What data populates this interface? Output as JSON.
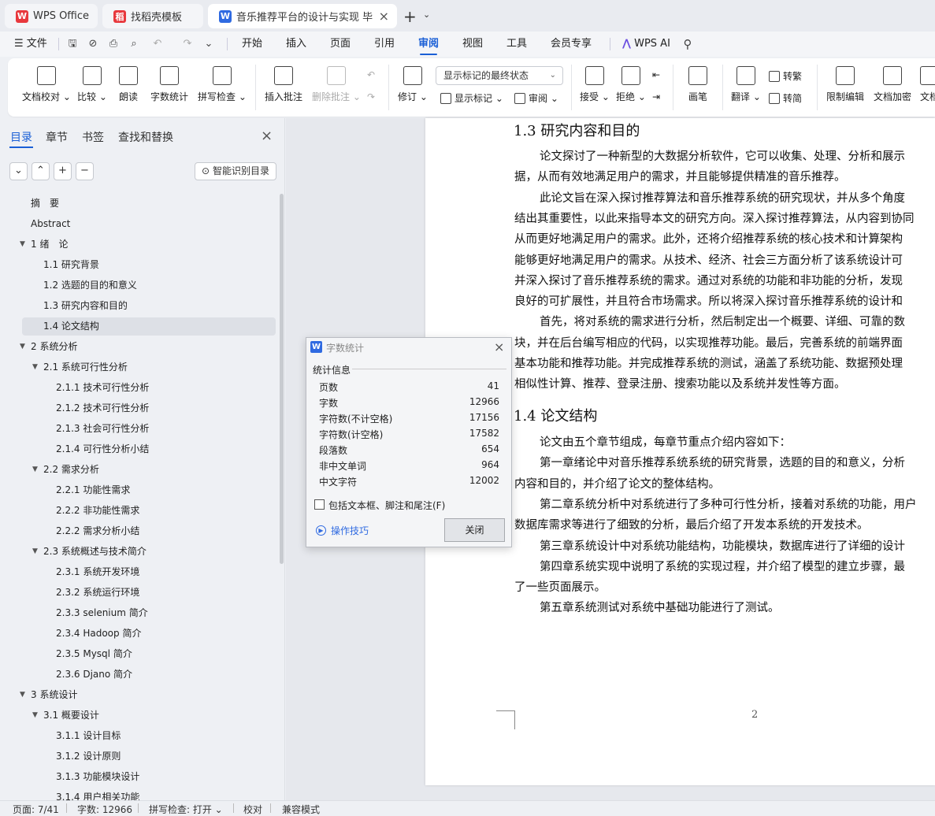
{
  "tabs": {
    "wps": "WPS Office",
    "template": "找稻壳模板",
    "document": "音乐推荐平台的设计与实现 毕"
  },
  "menu": {
    "file": "文件",
    "items": [
      "开始",
      "插入",
      "页面",
      "引用",
      "审阅",
      "视图",
      "工具",
      "会员专享"
    ],
    "active": "审阅",
    "wps_ai": "WPS AI"
  },
  "ribbon": {
    "doc_proof": "文档校对",
    "compare": "比较",
    "read_aloud": "朗读",
    "word_count": "字数统计",
    "spell_check": "拼写检查",
    "insert_comment": "插入批注",
    "delete_comment": "删除批注",
    "markup_mode": "显示标记的最终状态",
    "revise": "修订",
    "show_markup": "显示标记",
    "review": "审阅",
    "accept": "接受",
    "reject": "拒绝",
    "brush": "画笔",
    "translate": "翻译",
    "to_traditional": "转繁",
    "to_simplified": "转简",
    "restrict_edit": "限制编辑",
    "encrypt": "文档加密",
    "doc_more": "文档"
  },
  "nav": {
    "tabs": [
      "目录",
      "章节",
      "书签",
      "查找和替换"
    ],
    "smart_toc": "智能识别目录",
    "toc": [
      {
        "text": "摘　要",
        "level": 0,
        "caret": false
      },
      {
        "text": "Abstract",
        "level": 0,
        "caret": false
      },
      {
        "text": "1 绪　论",
        "level": 0,
        "caret": true
      },
      {
        "text": "1.1 研究背景",
        "level": 1,
        "caret": false
      },
      {
        "text": "1.2 选题的目的和意义",
        "level": 1,
        "caret": false
      },
      {
        "text": "1.3 研究内容和目的",
        "level": 1,
        "caret": false
      },
      {
        "text": "1.4  论文结构",
        "level": 1,
        "caret": false,
        "selected": true
      },
      {
        "text": "2  系统分析",
        "level": 0,
        "caret": true
      },
      {
        "text": "2.1 系统可行性分析",
        "level": 1,
        "caret": true
      },
      {
        "text": "2.1.1  技术可行性分析",
        "level": 2,
        "caret": false
      },
      {
        "text": "2.1.2  技术可行性分析",
        "level": 2,
        "caret": false
      },
      {
        "text": "2.1.3  社会可行性分析",
        "level": 2,
        "caret": false
      },
      {
        "text": "2.1.4  可行性分析小结",
        "level": 2,
        "caret": false
      },
      {
        "text": "2.2 需求分析",
        "level": 1,
        "caret": true
      },
      {
        "text": "2.2.1  功能性需求",
        "level": 2,
        "caret": false
      },
      {
        "text": "2.2.2  非功能性需求",
        "level": 2,
        "caret": false
      },
      {
        "text": "2.2.2  需求分析小结",
        "level": 2,
        "caret": false
      },
      {
        "text": "2.3 系统概述与技术简介",
        "level": 1,
        "caret": true
      },
      {
        "text": "2.3.1 系统开发环境",
        "level": 2,
        "caret": false
      },
      {
        "text": "2.3.2 系统运行环境",
        "level": 2,
        "caret": false
      },
      {
        "text": "2.3.3 selenium 简介",
        "level": 2,
        "caret": false
      },
      {
        "text": "2.3.4 Hadoop 简介",
        "level": 2,
        "caret": false
      },
      {
        "text": "2.3.5 Mysql 简介",
        "level": 2,
        "caret": false
      },
      {
        "text": "2.3.6 Djano 简介",
        "level": 2,
        "caret": false
      },
      {
        "text": "3 系统设计",
        "level": 0,
        "caret": true
      },
      {
        "text": "3.1  概要设计",
        "level": 1,
        "caret": true
      },
      {
        "text": "3.1.1 设计目标",
        "level": 2,
        "caret": false
      },
      {
        "text": "3.1.2  设计原则",
        "level": 2,
        "caret": false
      },
      {
        "text": "3.1.3  功能模块设计",
        "level": 2,
        "caret": false
      },
      {
        "text": "3.1.4  用户相关功能",
        "level": 2,
        "caret": false
      }
    ]
  },
  "document": {
    "heading_13": "1.3 研究内容和目的",
    "heading_14": "1.4  论文结构",
    "page_number": "2",
    "lines_a": [
      {
        "text": "论文探讨了一种新型的大数据分析软件，它可以收集、处理、分析和展示",
        "indent": true
      },
      {
        "text": "据，从而有效地满足用户的需求，并且能够提供精准的音乐推荐。",
        "indent": false
      },
      {
        "text": "此论文旨在深入探讨推荐算法和音乐推荐系统的研究现状，并从多个角度",
        "indent": true
      },
      {
        "text": "结出其重要性，以此来指导本文的研究方向。深入探讨推荐算法，从内容到协同",
        "indent": false
      },
      {
        "text": "从而更好地满足用户的需求。此外，还将介绍推荐系统的核心技术和计算架构",
        "indent": false
      },
      {
        "text": "能够更好地满足用户的需求。从技术、经济、社会三方面分析了该系统设计可",
        "indent": false
      },
      {
        "text": "并深入探讨了音乐推荐系统的需求。通过对系统的功能和非功能的分析，发现",
        "indent": false
      },
      {
        "text": "良好的可扩展性，并且符合市场需求。所以将深入探讨音乐推荐系统的设计和",
        "indent": false
      },
      {
        "text": "首先，将对系统的需求进行分析，然后制定出一个概要、详细、可靠的数",
        "indent": true
      },
      {
        "text": "块，并在后台编写相应的代码，以实现推荐功能。最后，完善系统的前端界面",
        "indent": false
      },
      {
        "text": "基本功能和推荐功能。并完成推荐系统的测试，涵盖了系统功能、数据预处理",
        "indent": false
      },
      {
        "text": "相似性计算、推荐、登录注册、搜索功能以及系统并发性等方面。",
        "indent": false
      }
    ],
    "lines_b": [
      {
        "text": "论文由五个章节组成，每章节重点介绍内容如下：",
        "indent": true
      },
      {
        "text": "第一章绪论中对音乐推荐系统系统的研究背景，选题的目的和意义，分析",
        "indent": true
      },
      {
        "text": "内容和目的，并介绍了论文的整体结构。",
        "indent": false
      },
      {
        "text": "第二章系统分析中对系统进行了多种可行性分析，接着对系统的功能，用户",
        "indent": true
      },
      {
        "text": "数据库需求等进行了细致的分析，最后介绍了开发本系统的开发技术。",
        "indent": false
      },
      {
        "text": "第三章系统设计中对系统功能结构，功能模块，数据库进行了详细的设计",
        "indent": true
      },
      {
        "text": "第四章系统实现中说明了系统的实现过程，并介绍了模型的建立步骤，最",
        "indent": true
      },
      {
        "text": "了一些页面展示。",
        "indent": false
      },
      {
        "text": "第五章系统测试对系统中基础功能进行了测试。",
        "indent": true
      }
    ]
  },
  "dialog": {
    "title": "字数统计",
    "section": "统计信息",
    "stats": [
      {
        "label": "页数",
        "value": "41"
      },
      {
        "label": "字数",
        "value": "12966"
      },
      {
        "label": "字符数(不计空格)",
        "value": "17156"
      },
      {
        "label": "字符数(计空格)",
        "value": "17582"
      },
      {
        "label": "段落数",
        "value": "654"
      },
      {
        "label": "非中文单词",
        "value": "964"
      },
      {
        "label": "中文字符",
        "value": "12002"
      }
    ],
    "checkbox_label": "包括文本框、脚注和尾注(F)",
    "tips": "操作技巧",
    "close": "关闭"
  },
  "status": {
    "page": "页面: 7/41",
    "words": "字数: 12966",
    "spell": "拼写检查: 打开",
    "proof": "校对",
    "compat": "兼容模式"
  },
  "colors": {
    "accent": "#1a5fd6",
    "wps_red": "#e8383d",
    "doc_blue": "#2f6ae1"
  }
}
